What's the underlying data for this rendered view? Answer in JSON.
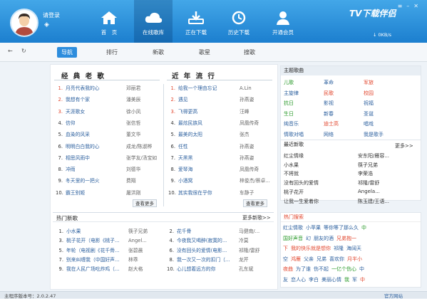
{
  "header": {
    "login": "请登录",
    "brand": "TV下载伴侣",
    "speed": "0KB/s",
    "nav": [
      {
        "label": "首　页"
      },
      {
        "label": "在线歌库"
      },
      {
        "label": "正在下载"
      },
      {
        "label": "历史下载"
      },
      {
        "label": "开通会员"
      }
    ]
  },
  "toolbar": {
    "tabs": [
      "导航",
      "排行",
      "新歌",
      "歌星",
      "搜歌"
    ]
  },
  "classic": {
    "title": "经 典 老 歌",
    "more": "查看更多",
    "rows": [
      [
        "1.",
        "月亮代表我的心",
        "邓丽君"
      ],
      [
        "2.",
        "我想有个家",
        "潘美辰"
      ],
      [
        "3.",
        "天涯歌女",
        "徐小凤"
      ],
      [
        "4.",
        "信仰",
        "张信哲"
      ],
      [
        "5.",
        "血染的风采",
        "董文华"
      ],
      [
        "6.",
        "明明白白我的心",
        "成龙/陈淑桦"
      ],
      [
        "7.",
        "相思风雨中",
        "张学友/汤宝如"
      ],
      [
        "8.",
        "冲雨",
        "刘德华"
      ],
      [
        "9.",
        "冬天里的一把火",
        "费翔"
      ],
      [
        "10.",
        "霸王别姬",
        "屠洪刚"
      ]
    ]
  },
  "recent": {
    "title": "近 年 流 行",
    "more": "查看更多",
    "rows": [
      [
        "1.",
        "给我一个理由忘记",
        "A.Lin"
      ],
      [
        "2.",
        "遇见",
        "孙燕姿"
      ],
      [
        "3.",
        "飞得更高",
        "汪峰"
      ],
      [
        "4.",
        "最炫民族风",
        "凤凰传奇"
      ],
      [
        "5.",
        "最美的太阳",
        "张杰"
      ],
      [
        "6.",
        "任性",
        "孙燕姿"
      ],
      [
        "7.",
        "天黑黑",
        "孙燕姿"
      ],
      [
        "8.",
        "爱琴海",
        "凤凰传奇"
      ],
      [
        "9.",
        "小酒窝",
        "林俊杰/蔡卓..."
      ],
      [
        "10.",
        "其实我很在乎你",
        "车静子"
      ]
    ]
  },
  "hotnew": {
    "title": "热门新歌",
    "more": "更多新歌>>",
    "left": [
      [
        "1.",
        "小水果",
        "筷子兄弟"
      ],
      [
        "3.",
        "桃子花开（电影《桃子...",
        "Angel..."
      ],
      [
        "5.",
        "年轮（电视剧《花千骨...",
        "张碧晨"
      ],
      [
        "7.",
        "别来纠缠我（中国好声...",
        "林乖"
      ],
      [
        "9.",
        "我在人民广场吃炸鸡（...",
        "赵大格"
      ]
    ],
    "right": [
      [
        "2.",
        "花千骨",
        "马健南/..."
      ],
      [
        "4.",
        "今夜我又喝醉(寂寞的...",
        "冷莫"
      ],
      [
        "6.",
        "没有回头的爱情(电影...",
        "祁隆/雷舒"
      ],
      [
        "8.",
        "我一次又一次的扣门（...",
        "龙芹"
      ],
      [
        "10.",
        "心儿想着远方的你",
        "孔东斌"
      ]
    ]
  },
  "theme": {
    "title": "主题歌曲",
    "items": [
      [
        "儿歌",
        "#2a9a2a"
      ],
      [
        "革命",
        "#2b5f9e"
      ],
      [
        "军旅",
        "#e2452c"
      ],
      [
        "主旋律",
        "#2b5f9e"
      ],
      [
        "民歌",
        "#e2452c"
      ],
      [
        "校园",
        "#e2452c"
      ],
      [
        "抗日",
        "#2a9a2a"
      ],
      [
        "影视",
        "#2b5f9e"
      ],
      [
        "祝福",
        "#2b5f9e"
      ],
      [
        "生日",
        "#2a9a2a"
      ],
      [
        "新春",
        "#2b5f9e"
      ],
      [
        "圣诞",
        "#2b5f9e"
      ],
      [
        "纯音乐",
        "#2b5f9e"
      ],
      [
        "迪士高",
        "#e2452c"
      ],
      [
        "唱戏",
        "#2b5f9e"
      ],
      [
        "情歌对唱",
        "#2b5f9e"
      ],
      [
        "网络",
        "#2b5f9e"
      ],
      [
        "我是歌手",
        "#2b5f9e"
      ]
    ]
  },
  "latest": {
    "title": "最近新歌",
    "more": "更多>>",
    "items": [
      [
        "红尘情缘",
        "安东阳/雁容..."
      ],
      [
        "小水果",
        "筷子兄弟"
      ],
      [
        "不将就",
        "李荣浩"
      ],
      [
        "没有回头的爱情",
        "祁隆/雷舒"
      ],
      [
        "桃子花开",
        "Angela..."
      ],
      [
        "让我一生爱着你",
        "陈玉建/王语..."
      ]
    ]
  },
  "search": {
    "title": "热门搜索",
    "lines": [
      [
        [
          "红尘情歌",
          "#2b5f9e"
        ],
        [
          "小苹果",
          "#2b5f9e"
        ],
        [
          "等你等了那么久",
          "#2b5f9e"
        ],
        [
          "中",
          "#2a9a2a"
        ]
      ],
      [
        [
          "国好声音",
          "#2a9a2a"
        ],
        [
          "幻",
          "#2b5f9e"
        ],
        [
          "朋友的酒",
          "#2b5f9e"
        ],
        [
          "兄弟抱一",
          "#e2452c"
        ]
      ],
      [
        [
          "下",
          "#e2452c"
        ],
        [
          "我的快乐就是想你",
          "#e2452c"
        ],
        [
          "祁隆",
          "#2b5f9e"
        ],
        [
          "海阔天",
          "#2b5f9e"
        ]
      ],
      [
        [
          "空",
          "#2b5f9e"
        ],
        [
          "鸿雁",
          "#e2452c"
        ],
        [
          "父亲",
          "#2b5f9e"
        ],
        [
          "兄弟",
          "#2b5f9e"
        ],
        [
          "喜欢你",
          "#2b5f9e"
        ],
        [
          "月半小",
          "#e2452c"
        ]
      ],
      [
        [
          "夜曲",
          "#e2452c"
        ],
        [
          "为了谁",
          "#2b5f9e"
        ],
        [
          "伤不起",
          "#2b5f9e"
        ],
        [
          "一亿个伤心",
          "#2a9a2a"
        ],
        [
          "中",
          "#2b5f9e"
        ]
      ],
      [
        [
          "友",
          "#2b5f9e"
        ],
        [
          "恋人心",
          "#2b5f9e"
        ],
        [
          "李白",
          "#2b5f9e"
        ],
        [
          "美丽心情",
          "#2b5f9e"
        ],
        [
          "我",
          "#2a9a2a"
        ],
        [
          "军",
          "#2b5f9e"
        ],
        [
          "中",
          "#e2452c"
        ]
      ]
    ]
  },
  "status": {
    "version": "主程序版本号：2.0.2.47",
    "site": "官方网站"
  }
}
